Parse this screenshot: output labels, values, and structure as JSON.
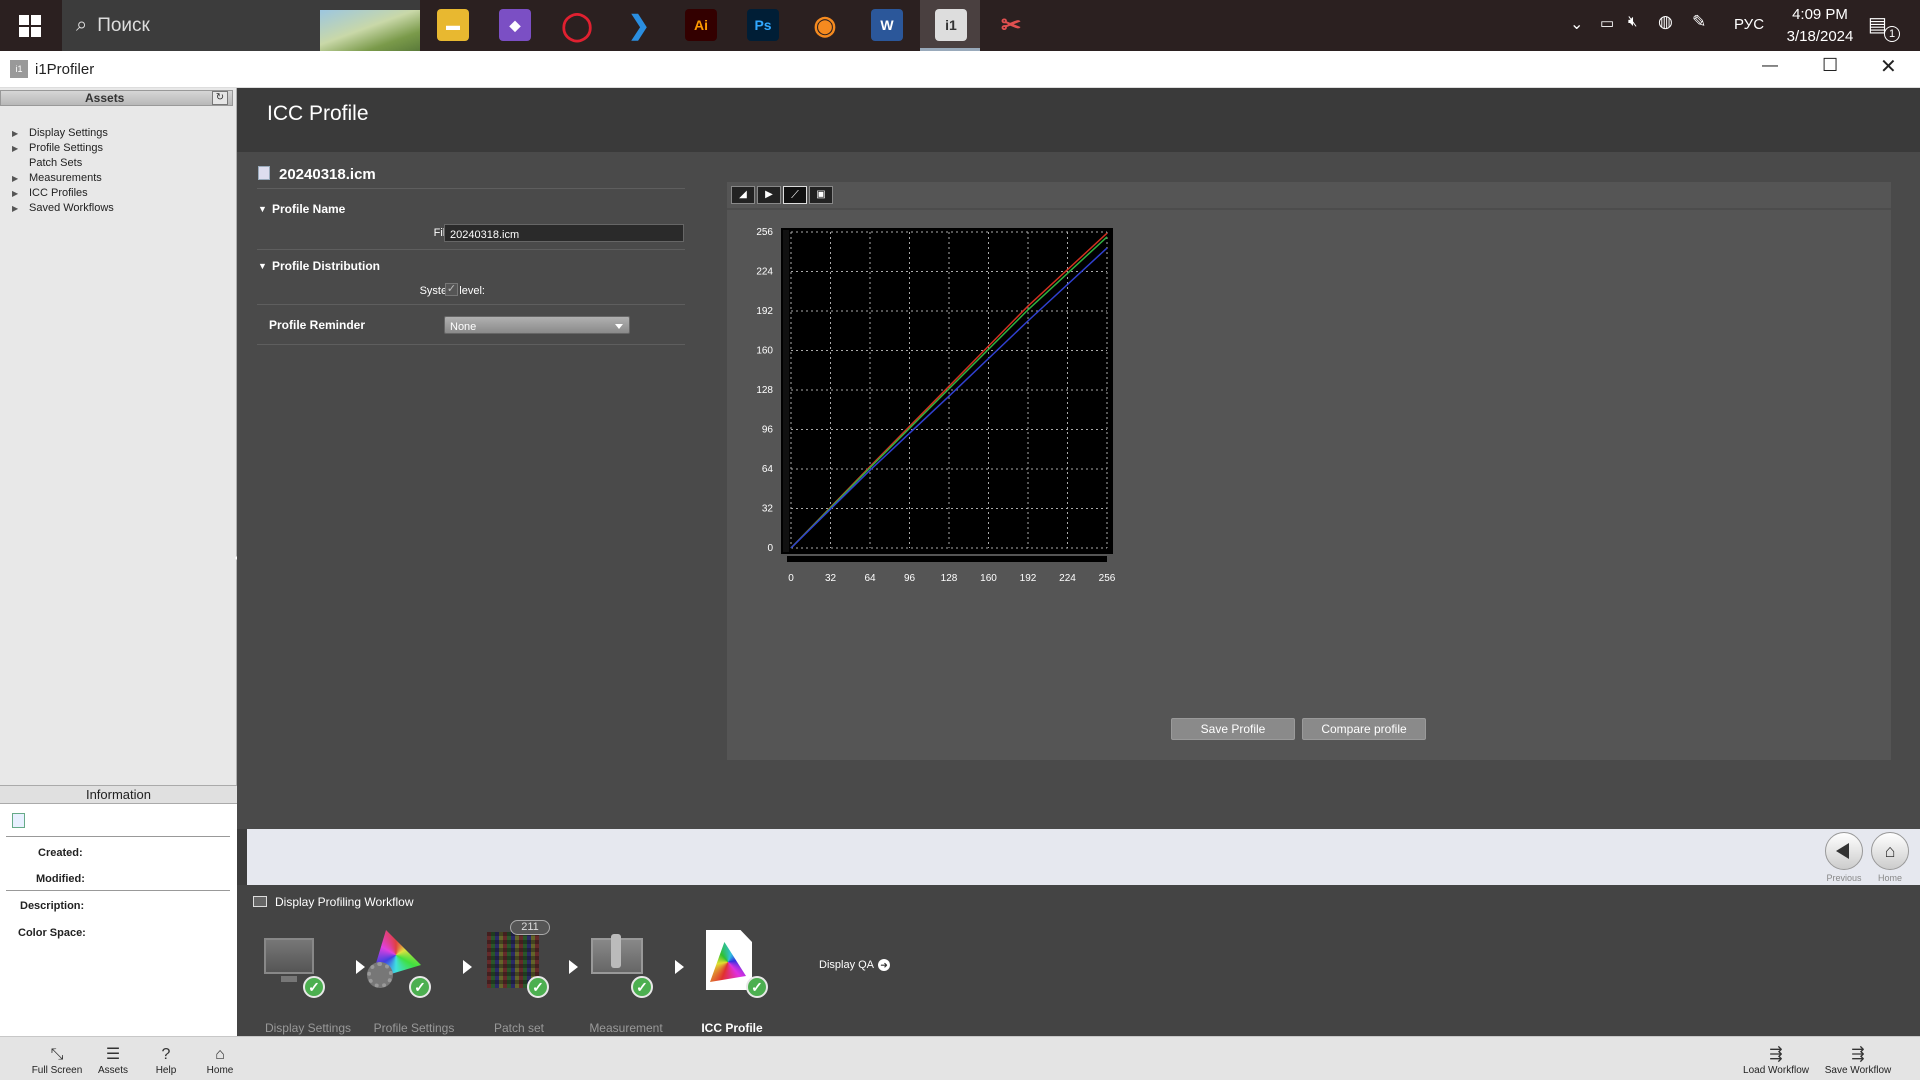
{
  "taskbar": {
    "search_placeholder": "Поиск",
    "language": "РУС",
    "time": "4:09 PM",
    "date": "3/18/2024",
    "notifications": "1"
  },
  "window": {
    "title": "i1Profiler"
  },
  "sidebar": {
    "header": "Assets",
    "items": [
      {
        "label": "Display Settings",
        "expandable": true
      },
      {
        "label": "Profile Settings",
        "expandable": true
      },
      {
        "label": "Patch Sets",
        "expandable": false
      },
      {
        "label": "Measurements",
        "expandable": true
      },
      {
        "label": "ICC Profiles",
        "expandable": true
      },
      {
        "label": "Saved Workflows",
        "expandable": true
      }
    ]
  },
  "info": {
    "header": "Information",
    "created_label": "Created:",
    "modified_label": "Modified:",
    "description_label": "Description:",
    "colorspace_label": "Color Space:"
  },
  "main": {
    "title": "ICC Profile",
    "filename": "20240318.icm",
    "profile_name": {
      "header": "Profile Name",
      "file_label": "File name:",
      "file_value": "20240318.icm"
    },
    "distribution": {
      "header": "Profile Distribution",
      "system_label": "System level:"
    },
    "reminder": {
      "label": "Profile Reminder",
      "value": "None"
    },
    "save_button": "Save Profile",
    "compare_button": "Compare profile"
  },
  "chart_data": {
    "type": "line",
    "xlim": [
      0,
      256
    ],
    "ylim": [
      0,
      256
    ],
    "x_ticks": [
      0,
      32,
      64,
      96,
      128,
      160,
      192,
      224,
      256
    ],
    "y_ticks": [
      0,
      32,
      64,
      96,
      128,
      160,
      192,
      224,
      256
    ],
    "grid": true,
    "series": [
      {
        "color": "#d03020",
        "x": [
          0,
          64,
          128,
          192,
          256
        ],
        "y": [
          0,
          66,
          131,
          196,
          255
        ]
      },
      {
        "color": "#30b040",
        "x": [
          0,
          64,
          128,
          192,
          256
        ],
        "y": [
          0,
          65,
          129,
          193,
          252
        ]
      },
      {
        "color": "#3040d0",
        "x": [
          0,
          64,
          128,
          192,
          256
        ],
        "y": [
          0,
          63,
          123,
          184,
          243
        ]
      }
    ]
  },
  "nav": {
    "previous": "Previous",
    "home": "Home"
  },
  "workflow": {
    "title": "Display Profiling Workflow",
    "patch_count": "211",
    "display_qa": "Display QA",
    "steps": [
      "Display Settings",
      "Profile Settings",
      "Patch set",
      "Measurement",
      "ICC Profile"
    ]
  },
  "bottom": {
    "fullscreen": "Full Screen",
    "assets": "Assets",
    "help": "Help",
    "home": "Home",
    "load": "Load Workflow",
    "save": "Save Workflow"
  }
}
